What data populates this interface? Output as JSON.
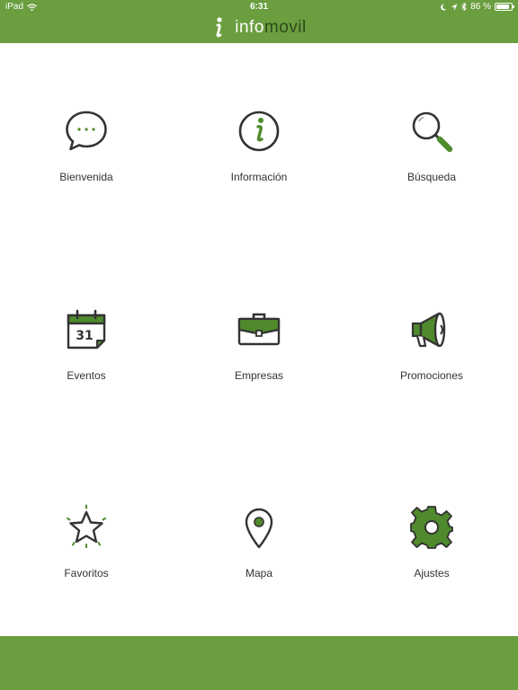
{
  "status_bar": {
    "carrier": "iPad",
    "time": "6:31",
    "battery": "86 %",
    "battery_level": 0.86
  },
  "header": {
    "logo_info": "info",
    "logo_movil": "movil"
  },
  "menu": [
    {
      "label": "Bienvenida",
      "icon": "chat-bubble-icon"
    },
    {
      "label": "Información",
      "icon": "info-icon"
    },
    {
      "label": "Búsqueda",
      "icon": "magnifier-icon"
    },
    {
      "label": "Eventos",
      "icon": "calendar-icon"
    },
    {
      "label": "Empresas",
      "icon": "briefcase-icon"
    },
    {
      "label": "Promociones",
      "icon": "megaphone-icon"
    },
    {
      "label": "Favoritos",
      "icon": "star-icon"
    },
    {
      "label": "Mapa",
      "icon": "map-pin-icon"
    },
    {
      "label": "Ajustes",
      "icon": "gear-icon"
    }
  ],
  "calendar_day": "31",
  "colors": {
    "brand_green": "#6a9e3f",
    "icon_green": "#4f8a2c",
    "dark_green": "#2e4a1b",
    "icon_stroke": "#333333"
  }
}
